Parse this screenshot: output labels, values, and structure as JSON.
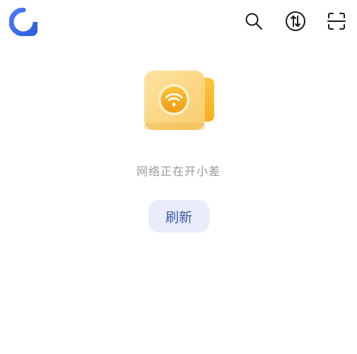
{
  "header": {
    "icons": {
      "logo": "app-logo-icon",
      "search": "search-icon",
      "transfer": "upload-download-icon",
      "scan": "scan-icon"
    },
    "colors": {
      "logo": "#3d6cf0",
      "icon": "#1a1a1a"
    }
  },
  "main": {
    "illustration": "wifi-card-illustration",
    "message": "网络正在开小差",
    "refresh_label": "刷新",
    "colors": {
      "message": "#9a9a9a",
      "button_bg": "#e9ecfb",
      "button_text": "#3f5aa8",
      "card_front": "#fbd780",
      "card_back": "#f9b82a",
      "wifi": "#f3a71b"
    }
  }
}
